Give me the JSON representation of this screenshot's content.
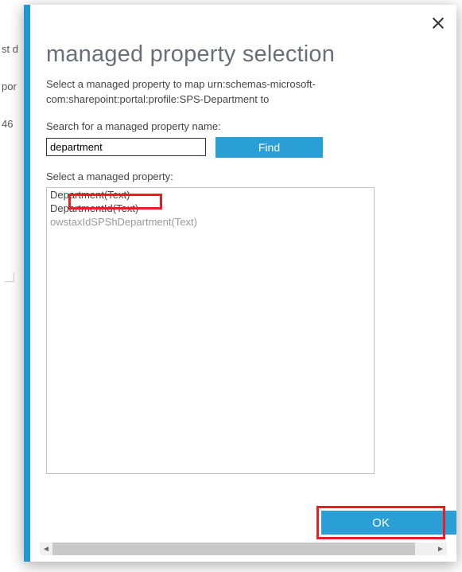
{
  "backdrop": {
    "line1": "st d",
    "line2": "por",
    "line3": "46"
  },
  "dialog": {
    "title": "managed property selection",
    "intro": "Select a managed property to map urn:schemas-microsoft-com:sharepoint:portal:profile:SPS-Department to",
    "search_label": "Search for a managed property name:",
    "search_value": "department",
    "find_label": "Find",
    "select_label": "Select a managed property:",
    "results": [
      {
        "label": "Department(Text)",
        "muted": false
      },
      {
        "label": "DepartmentId(Text)",
        "muted": false
      },
      {
        "label": "owstaxIdSPShDepartment(Text)",
        "muted": true
      }
    ],
    "ok_label": "OK"
  }
}
